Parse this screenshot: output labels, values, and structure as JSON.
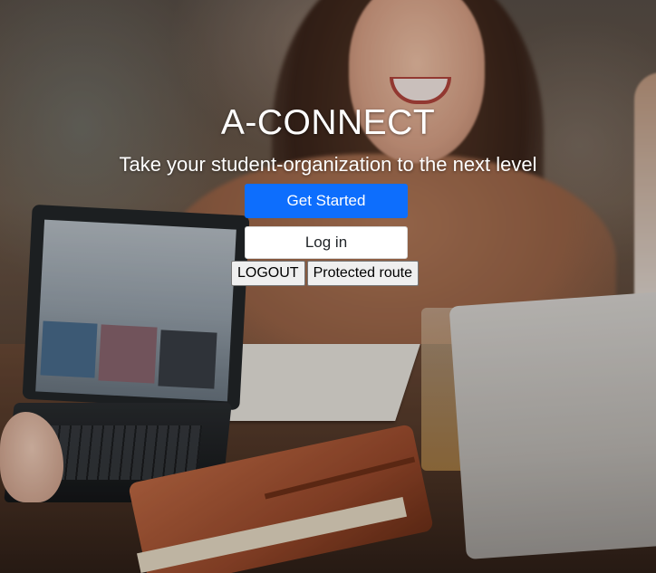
{
  "hero": {
    "title": "A-CONNECT",
    "subtitle": "Take your student-organization to the next level",
    "get_started_label": "Get Started",
    "login_label": "Log in",
    "logout_label": "LOGOUT",
    "protected_route_label": "Protected route"
  },
  "colors": {
    "primary": "#0d6efd",
    "title_text": "#ffffff",
    "light_button": "#ffffff"
  }
}
